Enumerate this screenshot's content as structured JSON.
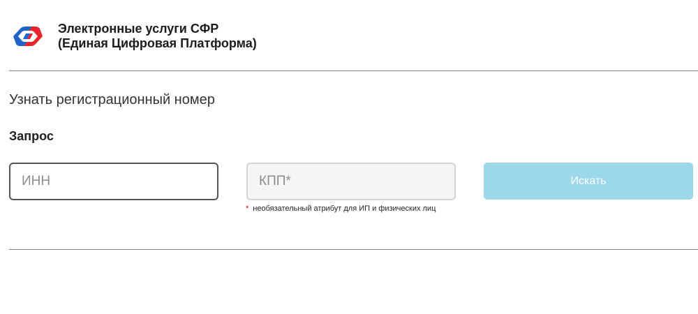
{
  "header": {
    "logo_icon": "sfr-logo-icon",
    "title_line1": "Электронные услуги СФР",
    "title_line2": "(Единая Цифровая Платформа)"
  },
  "main": {
    "page_title": "Узнать регистрационный номер",
    "section_title": "Запрос",
    "inn_field": {
      "value": "",
      "placeholder": "ИНН"
    },
    "kpp_field": {
      "value": "",
      "placeholder": "КПП*"
    },
    "note": {
      "marker": "*",
      "text": "необязательный атрибут для ИП и физических лиц"
    },
    "search_button_label": "Искать"
  },
  "colors": {
    "logo_blue": "#1f63c9",
    "logo_red": "#e5242b",
    "button_disabled": "#9dd7ea",
    "required_marker": "#d40000"
  }
}
